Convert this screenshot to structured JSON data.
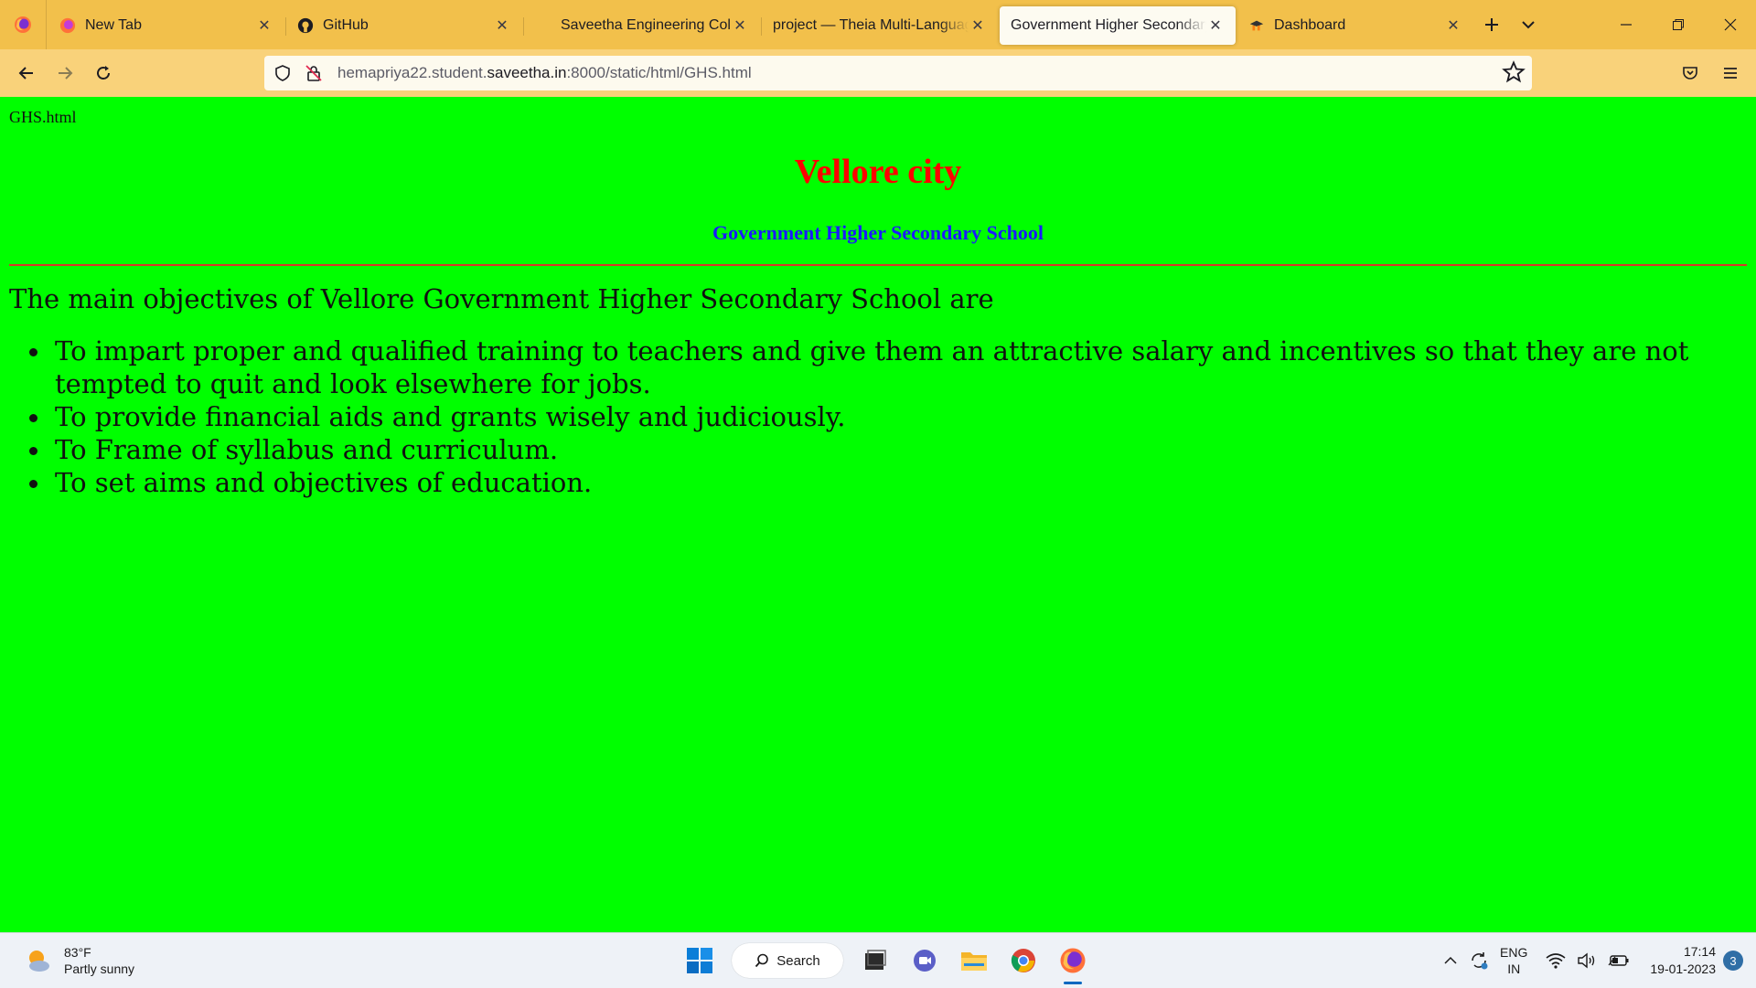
{
  "browser": {
    "tabs": [
      {
        "title": "New Tab",
        "icon": "firefox-icon",
        "active": false
      },
      {
        "title": "GitHub",
        "icon": "github-icon",
        "active": false
      },
      {
        "title": "Saveetha Engineering College",
        "icon": "none",
        "active": false
      },
      {
        "title": "project — Theia Multi-Language",
        "icon": "none",
        "active": false
      },
      {
        "title": "Government Higher Secondary S",
        "icon": "none",
        "active": true
      },
      {
        "title": "Dashboard",
        "icon": "moodle-icon",
        "active": false
      }
    ],
    "url": {
      "prefix": "hemapriya22.student.",
      "domain": "saveetha.in",
      "suffix": ":8000/static/html/GHS.html"
    }
  },
  "page": {
    "filename": "GHS.html",
    "heading": "Vellore city",
    "subheading": "Government Higher Secondary School",
    "intro": "The main objectives of Vellore Government Higher Secondary School are",
    "objectives": [
      "To impart proper and qualified training to teachers and give them an attractive salary and incentives so that they are not tempted to quit and look elsewhere for jobs.",
      "To provide financial aids and grants wisely and judiciously.",
      "To Frame of syllabus and curriculum.",
      "To set aims and objectives of education."
    ],
    "colors": {
      "background": "#00ff00",
      "heading": "#ff0000",
      "subheading": "#1a1aff",
      "rule": "#d9342a"
    }
  },
  "taskbar": {
    "weather": {
      "temp": "83°F",
      "desc": "Partly sunny"
    },
    "search_label": "Search",
    "lang": {
      "line1": "ENG",
      "line2": "IN"
    },
    "clock": {
      "time": "17:14",
      "date": "19-01-2023"
    },
    "notifications": "3"
  }
}
